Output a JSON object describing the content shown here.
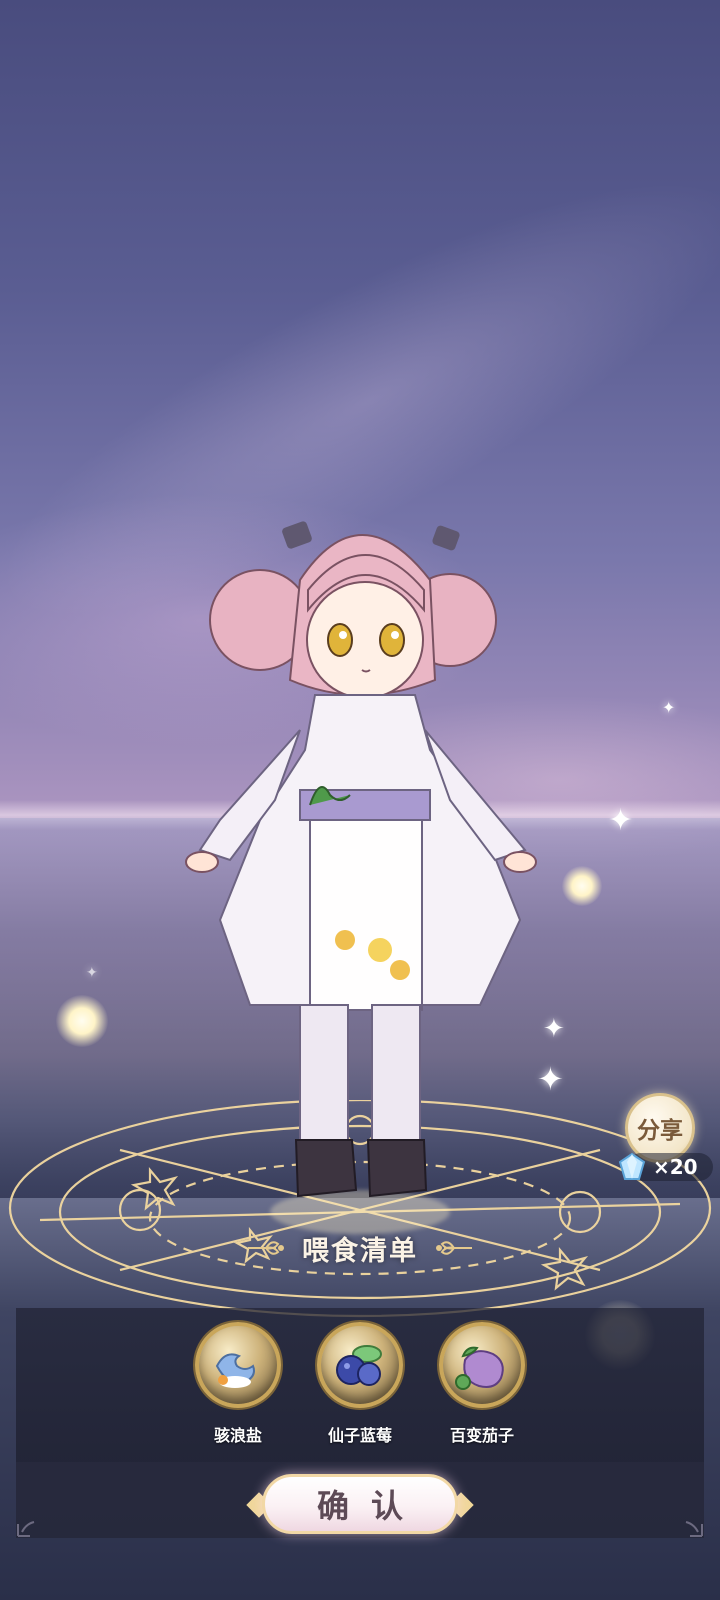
{
  "share": {
    "label": "分享",
    "reward_count": "×20",
    "reward_icon": "diamond-gem-icon"
  },
  "feed_list": {
    "title": "喂食清单",
    "items": [
      {
        "label": "骇浪盐",
        "icon": "wave-salt-icon"
      },
      {
        "label": "仙子蓝莓",
        "icon": "blueberry-icon"
      },
      {
        "label": "百变茄子",
        "icon": "eggplant-icon"
      }
    ]
  },
  "confirm": {
    "label": "确认"
  },
  "colors": {
    "panel": "#22243a",
    "gold": "#c9a65a",
    "button_text": "#5d4a56"
  }
}
